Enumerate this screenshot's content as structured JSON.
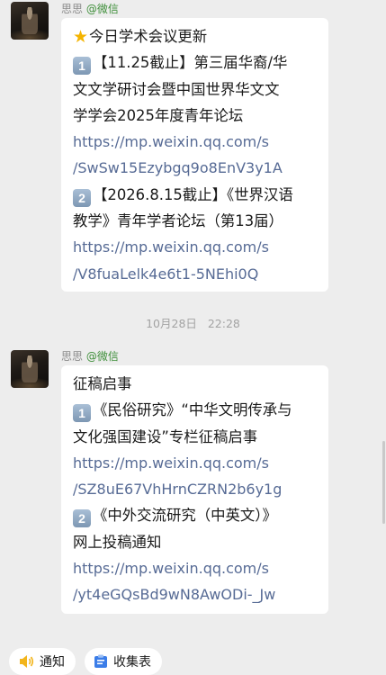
{
  "messages": [
    {
      "sender_name": "思思",
      "sender_source": "@微信",
      "lines": [
        {
          "star": true,
          "text": "今日学术会议更新"
        },
        {
          "num": "1",
          "text": "【11.25截止】第三届华裔/华"
        },
        {
          "text": "文文学研讨会暨中国世界华文文"
        },
        {
          "text": "学学会2025年度青年论坛"
        },
        {
          "link": true,
          "text": "https://mp.weixin.qq.com/s"
        },
        {
          "link": true,
          "text": "/SwSw15Ezybgq9o8EnV3y1A"
        },
        {
          "num": "2",
          "text": "【2026.8.15截止】《世界汉语"
        },
        {
          "text": "教学》青年学者论坛（第13届）"
        },
        {
          "link": true,
          "text": "https://mp.weixin.qq.com/s"
        },
        {
          "link": true,
          "text": "/V8fuaLelk4e6t1-5NEhi0Q"
        }
      ]
    },
    {
      "sender_name": "思思",
      "sender_source": "@微信",
      "lines": [
        {
          "text": "征稿启事"
        },
        {
          "num": "1",
          "text": "《民俗研究》“中华文明传承与"
        },
        {
          "text": "文化强国建设”专栏征稿启事"
        },
        {
          "link": true,
          "text": "https://mp.weixin.qq.com/s"
        },
        {
          "link": true,
          "text": "/SZ8uE67VhHrnCZRN2b6y1g"
        },
        {
          "num": "2",
          "text": "《中外交流研究（中英文）》"
        },
        {
          "text": "网上投稿通知"
        },
        {
          "link": true,
          "text": "https://mp.weixin.qq.com/s"
        },
        {
          "link": true,
          "text": "/yt4eGQsBd9wN8AwODi-_Jw"
        }
      ]
    }
  ],
  "timestamp": "10月28日   22:28",
  "bottom_bar": {
    "notice_label": "通知",
    "form_label": "收集表"
  },
  "colors": {
    "link": "#576b95",
    "source_green": "#3f8f3a",
    "background": "#ededed"
  },
  "icons": [
    "avatar",
    "star-icon",
    "number-1-icon",
    "number-2-icon",
    "speaker-icon",
    "form-icon"
  ]
}
